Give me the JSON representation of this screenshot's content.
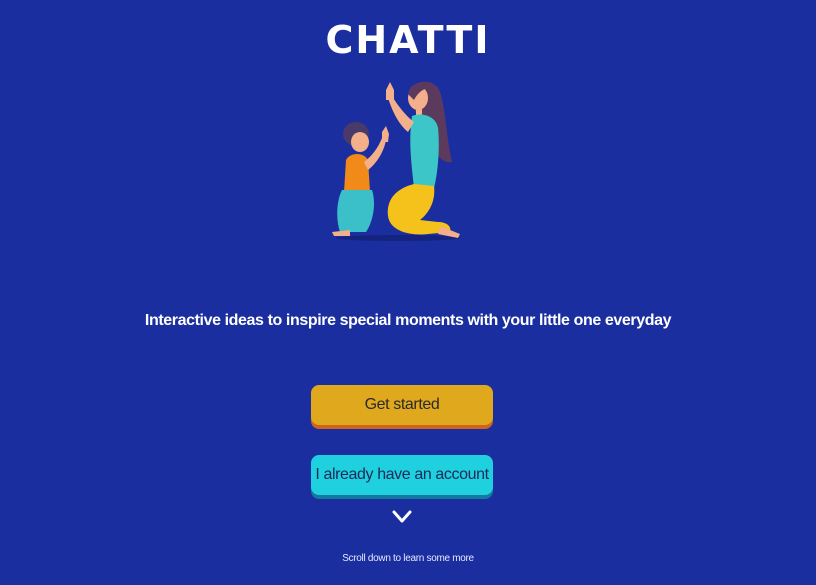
{
  "brand": {
    "logo_text": "CHATTI"
  },
  "hero": {
    "illustration_icon": "mother-child-high-five-illustration",
    "tagline": "Interactive ideas to inspire special moments with your little one everyday"
  },
  "actions": {
    "get_started_label": "Get started",
    "login_label": "I already have an account"
  },
  "footer": {
    "chevron_icon": "chevron-down-icon",
    "scroll_hint": "Scroll down to learn some more"
  },
  "colors": {
    "background": "#1a2ea0",
    "primary_button": "#dfa81d",
    "primary_button_shadow": "#d0621e",
    "secondary_button": "#1fd0de",
    "secondary_button_shadow": "#1479a0"
  }
}
